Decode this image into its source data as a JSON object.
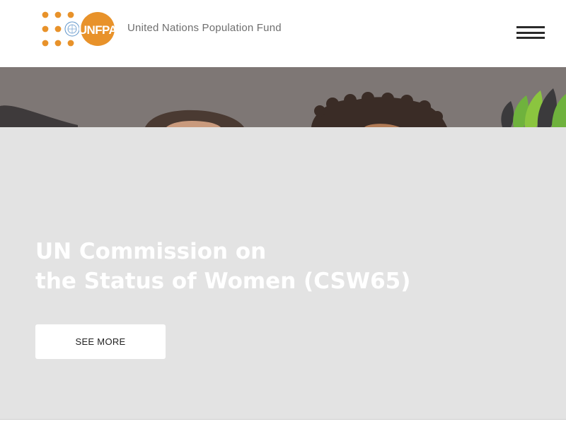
{
  "header": {
    "logo_text": "UNFPA",
    "org_name": "United Nations Population Fund",
    "menu_icon": "hamburger-menu-icon"
  },
  "hero": {
    "title_line1": "UN Commission on",
    "title_line2": "the Status of Women (CSW65)",
    "cta_label": "SEE MORE"
  },
  "colors": {
    "brand_orange": "#e8922a",
    "hero_overlay": "#e3e3e3",
    "hero_art_bg": "#7e7775",
    "text_gray": "#6f6f6f"
  }
}
